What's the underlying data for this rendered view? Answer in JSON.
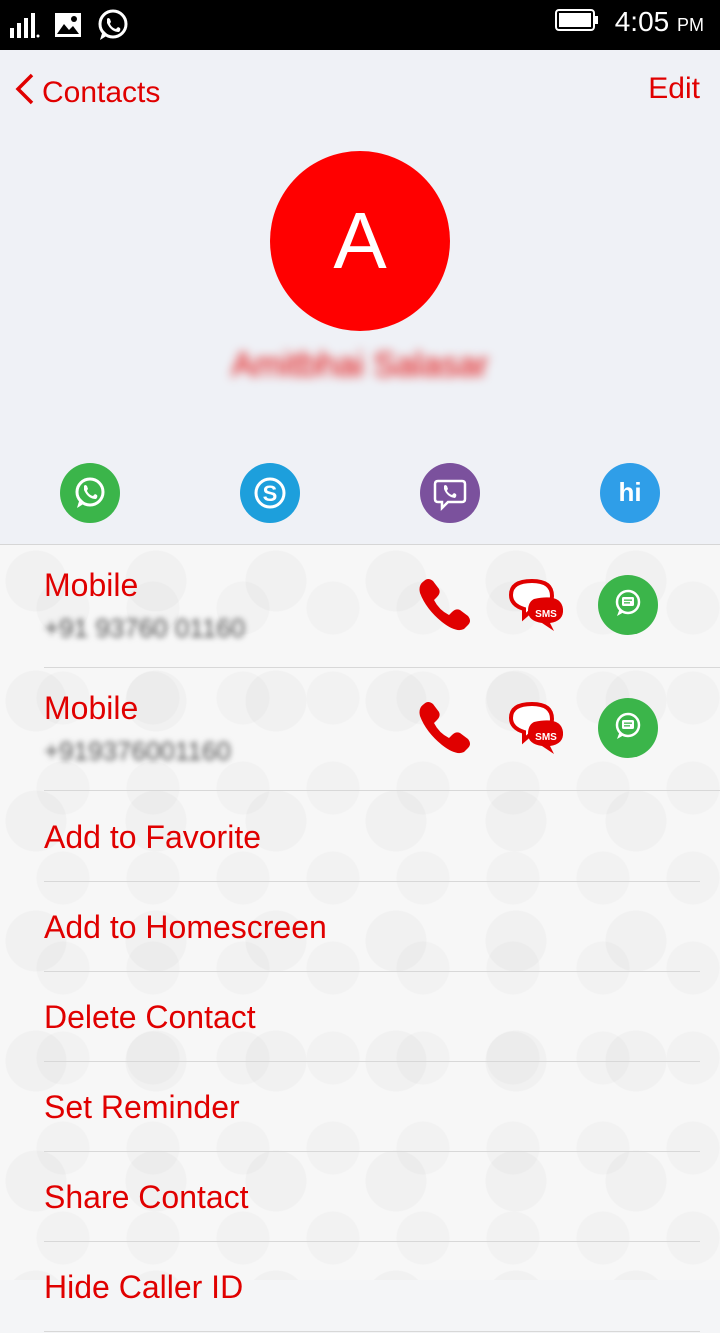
{
  "status_bar": {
    "time": "4:05",
    "ampm": "PM"
  },
  "nav": {
    "back_label": "Contacts",
    "edit_label": "Edit"
  },
  "contact": {
    "initial": "A",
    "name": "Amitbhai Salasar"
  },
  "apps": [
    {
      "name": "whatsapp-icon",
      "color": "#3bb54a"
    },
    {
      "name": "skype-icon",
      "color": "#1d9fdc"
    },
    {
      "name": "viber-icon",
      "color": "#7b519d"
    },
    {
      "name": "hike-icon",
      "color": "#2f9ee8"
    }
  ],
  "phones": [
    {
      "label": "Mobile",
      "number": "+91 93760 01160"
    },
    {
      "label": "Mobile",
      "number": "+919376001160"
    }
  ],
  "actions": [
    "Add to Favorite",
    "Add to Homescreen",
    "Delete Contact",
    "Set Reminder",
    "Share Contact",
    "Hide Caller ID"
  ],
  "colors": {
    "accent": "#e00000",
    "avatar": "#ff0000"
  }
}
